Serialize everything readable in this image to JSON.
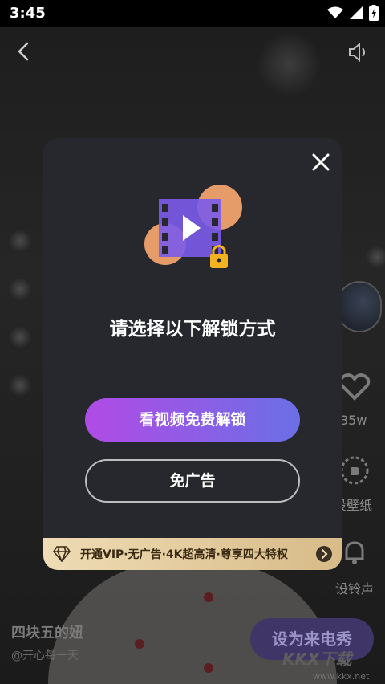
{
  "status_bar": {
    "time": "3:45"
  },
  "video": {
    "author_name": "四块五的妞",
    "author_handle": "@开心每一天",
    "like_count": "35w"
  },
  "side_actions": {
    "wallpaper_label": "设壁纸",
    "ringtone_label": "设铃声"
  },
  "set_ringtone_button": "设为来电秀",
  "watermark": {
    "brand": "KKX下载",
    "url": "www.kkx.net"
  },
  "dialog": {
    "title": "请选择以下解锁方式",
    "primary_button": "看视频免费解锁",
    "secondary_button": "免广告",
    "vip_banner": "开通VIP·无广告·4K超高清·尊享四大特权"
  },
  "colors": {
    "dialog_bg": "#26282d",
    "primary_gradient_start": "#b14be6",
    "primary_gradient_end": "#6b6fe6",
    "vip_gold": "#e7cf9f"
  },
  "icons": [
    "back-icon",
    "volume-icon",
    "close-icon",
    "video-lock-icon",
    "diamond-icon",
    "chevron-right-icon",
    "heart-icon",
    "wallpaper-icon",
    "ringtone-icon",
    "wifi-icon",
    "signal-icon",
    "battery-icon"
  ]
}
